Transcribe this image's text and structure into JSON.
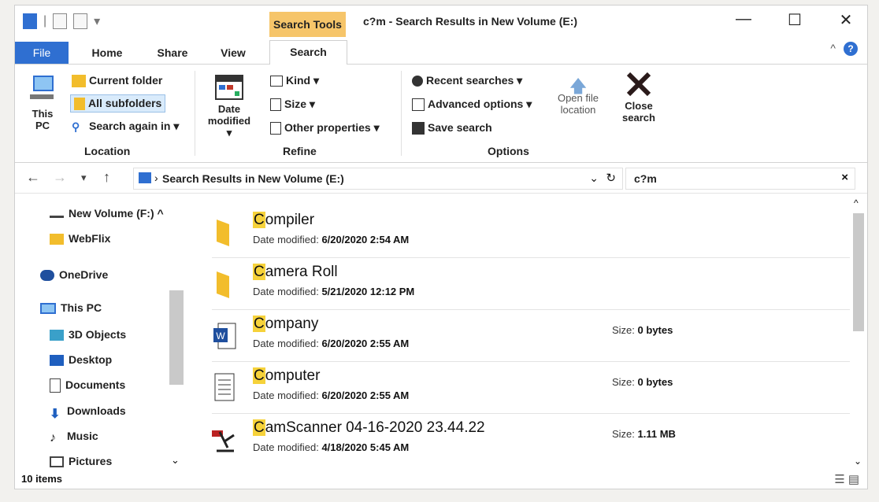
{
  "window": {
    "title": "c?m - Search Results in New Volume (E:)",
    "context_tab": "Search Tools",
    "controls": {
      "minimize": "—",
      "maximize": "☐",
      "close": "✕"
    }
  },
  "tabs": {
    "file": "File",
    "home": "Home",
    "share": "Share",
    "view": "View",
    "search": "Search"
  },
  "ribbon": {
    "location": {
      "this_pc": "This PC",
      "current_folder": "Current folder",
      "all_subfolders": "All subfolders",
      "search_again_in": "Search again in ▾",
      "label": "Location"
    },
    "refine": {
      "date_modified": "Date modified ▾",
      "kind": "Kind ▾",
      "size": "Size ▾",
      "other_properties": "Other properties ▾",
      "label": "Refine"
    },
    "options": {
      "recent_searches": "Recent searches ▾",
      "advanced_options": "Advanced options ▾",
      "save_search": "Save search",
      "open_file_location": "Open file location",
      "close_search": "Close search",
      "label": "Options"
    }
  },
  "address": {
    "path": "Search Results in New Volume (E:)",
    "search_value": "c?m"
  },
  "sidebar": {
    "items": [
      {
        "label": "New Volume (F:)",
        "icon": "drive-icon"
      },
      {
        "label": "WebFlix",
        "icon": "folder-icon"
      },
      {
        "label": "OneDrive",
        "icon": "cloud-icon"
      },
      {
        "label": "This PC",
        "icon": "computer-icon"
      },
      {
        "label": "3D Objects",
        "icon": "cube-icon"
      },
      {
        "label": "Desktop",
        "icon": "desktop-icon"
      },
      {
        "label": "Documents",
        "icon": "document-icon"
      },
      {
        "label": "Downloads",
        "icon": "download-icon"
      },
      {
        "label": "Music",
        "icon": "music-icon"
      },
      {
        "label": "Pictures",
        "icon": "pictures-icon"
      }
    ]
  },
  "results": {
    "date_label": "Date modified:",
    "size_label": "Size:",
    "items": [
      {
        "first": "C",
        "rest": "ompiler",
        "date": "6/20/2020 2:54 AM",
        "size": "",
        "icon": "folder-icon"
      },
      {
        "first": "C",
        "rest": "amera Roll",
        "date": "5/21/2020 12:12 PM",
        "size": "",
        "icon": "folder-icon"
      },
      {
        "first": "C",
        "rest": "ompany",
        "date": "6/20/2020 2:55 AM",
        "size": "0 bytes",
        "icon": "word-icon"
      },
      {
        "first": "C",
        "rest": "omputer",
        "date": "6/20/2020 2:55 AM",
        "size": "0 bytes",
        "icon": "text-file-icon"
      },
      {
        "first": "C",
        "rest": "amScanner 04-16-2020 23.44.22",
        "date": "4/18/2020 5:45 AM",
        "size": "1.11 MB",
        "icon": "pdf-icon"
      }
    ]
  },
  "status": {
    "count": "10 items"
  },
  "colors": {
    "accent": "#2f6fd1",
    "folder": "#f2bd2c",
    "highlight": "#f6d23a",
    "context_tab": "#f6c56a",
    "close_x": "#2a1a1a"
  }
}
